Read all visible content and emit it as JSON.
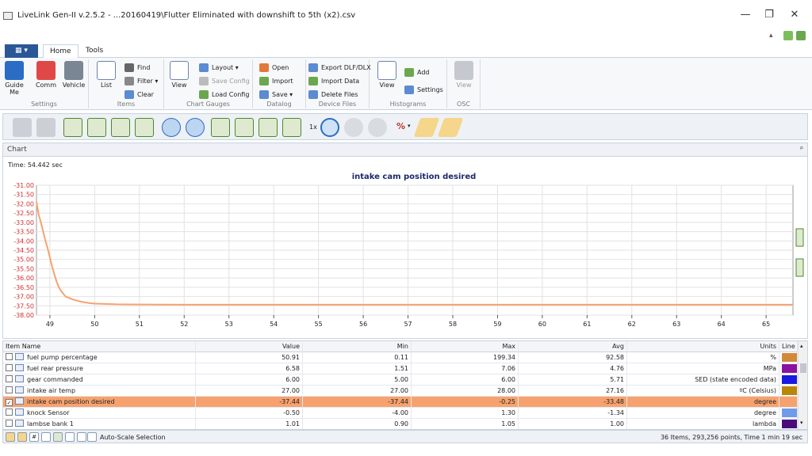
{
  "window": {
    "title": "LiveLink Gen-II  v.2.5.2 - ...20160419\\Flutter Eliminated with downshift to 5th (x2).csv",
    "minimize": "—",
    "maximize": "❐",
    "close": "✕"
  },
  "tabs": [
    {
      "label": "Home"
    },
    {
      "label": "Tools"
    }
  ],
  "ribbon": {
    "guide_label": "Guide\nMe",
    "comm_label": "Comm",
    "vehicle_label": "Vehicle",
    "settings_group": "Settings",
    "list_label": "List",
    "find_label": "Find",
    "filter_label": "Filter ▾",
    "clear_label": "Clear",
    "items_group": "Items",
    "view_label": "View",
    "layout_label": "Layout",
    "save_config_label": "Save Config",
    "load_config_label": "Load Config",
    "chart_gauges_group": "Chart  Gauges",
    "open_label": "Open",
    "import_label": "Import",
    "save_label": "Save ▾",
    "datalog_group": "Datalog",
    "export_label": "Export DLF/DLX",
    "import_data_label": "Import Data",
    "delete_files_label": "Delete Files",
    "device_files_group": "Device Files",
    "hist_view_label": "View",
    "add_label": "Add",
    "hist_settings_label": "Settings",
    "histograms_group": "Histograms",
    "osc_view_label": "View",
    "osc_group": "OSC"
  },
  "toolbar": {
    "speed_label": "1x",
    "percent_label": "%"
  },
  "chart_panel": {
    "header": "Chart",
    "pin": "ᵖ",
    "time_label": "Time: 54.442 sec"
  },
  "chart_data": {
    "type": "line",
    "title": "intake cam position desired",
    "xlabel": "",
    "ylabel": "",
    "xlim": [
      48.7,
      65.6
    ],
    "ylim": [
      -38.0,
      -31.0
    ],
    "xticks": [
      "49",
      "50",
      "51",
      "52",
      "53",
      "54",
      "55",
      "56",
      "57",
      "58",
      "59",
      "60",
      "61",
      "62",
      "63",
      "64",
      "65"
    ],
    "yticks": [
      "-31.00",
      "-31.50",
      "-32.00",
      "-32.50",
      "-33.00",
      "-33.50",
      "-34.00",
      "-34.50",
      "-35.00",
      "-35.50",
      "-36.00",
      "-36.50",
      "-37.00",
      "-37.50",
      "-38.00"
    ],
    "grid": true,
    "series": [
      {
        "color": "#f7a26e",
        "x": [
          48.7,
          48.75,
          48.8,
          48.85,
          48.9,
          48.95,
          49.0,
          49.05,
          49.1,
          49.15,
          49.2,
          49.25,
          49.3,
          49.35,
          49.4,
          49.5,
          49.6,
          49.7,
          49.8,
          49.9,
          50.0,
          50.2,
          50.5,
          51.0,
          52.0,
          53.0,
          54.0,
          55.0,
          56.0,
          57.0,
          58.0,
          59.0,
          60.0,
          61.0,
          62.0,
          63.0,
          64.0,
          65.0,
          65.6
        ],
        "y": [
          -31.9,
          -32.6,
          -33.0,
          -33.5,
          -34.0,
          -34.4,
          -34.9,
          -35.4,
          -35.8,
          -36.2,
          -36.5,
          -36.7,
          -36.85,
          -37.0,
          -37.05,
          -37.15,
          -37.22,
          -37.28,
          -37.32,
          -37.36,
          -37.38,
          -37.4,
          -37.42,
          -37.43,
          -37.44,
          -37.44,
          -37.44,
          -37.44,
          -37.44,
          -37.44,
          -37.44,
          -37.44,
          -37.44,
          -37.44,
          -37.44,
          -37.44,
          -37.44,
          -37.44,
          -37.44
        ]
      }
    ]
  },
  "grid": {
    "headers": {
      "name": "Item Name",
      "value": "Value",
      "min": "Min",
      "max": "Max",
      "avg": "Avg",
      "units": "Units",
      "line": "Line"
    },
    "rows": [
      {
        "checked": "",
        "name": "fuel pump percentage",
        "value": "50.91",
        "min": "0.11",
        "max": "199.34",
        "avg": "92.58",
        "units": "%",
        "color": "#d08a3a"
      },
      {
        "checked": "",
        "name": "fuel rear pressure",
        "value": "6.58",
        "min": "1.51",
        "max": "7.06",
        "avg": "4.76",
        "units": "MPa",
        "color": "#8a12a0"
      },
      {
        "checked": "",
        "name": "gear commanded",
        "value": "6.00",
        "min": "5.00",
        "max": "6.00",
        "avg": "5.71",
        "units": "SED (state encoded data)",
        "color": "#1a1ae0"
      },
      {
        "checked": "",
        "name": "intake air temp",
        "value": "27.00",
        "min": "27.00",
        "max": "28.00",
        "avg": "27.16",
        "units": "ºC (Celsius)",
        "color": "#b8860b"
      },
      {
        "checked": "✓",
        "name": "intake cam position desired",
        "value": "-37.44",
        "min": "-37.44",
        "max": "-0.25",
        "avg": "-33.48",
        "units": "degree",
        "color": "#f7a26e"
      },
      {
        "checked": "",
        "name": "knock Sensor",
        "value": "-0.50",
        "min": "-4.00",
        "max": "1.30",
        "avg": "-1.34",
        "units": "degree",
        "color": "#6f9be8"
      },
      {
        "checked": "",
        "name": "lambse bank 1",
        "value": "1.01",
        "min": "0.90",
        "max": "1.05",
        "avg": "1.00",
        "units": "lambda",
        "color": "#4a0a7a"
      }
    ]
  },
  "statusbar": {
    "autoscale_label": "Auto-Scale Selection",
    "summary": "36 Items, 293,256 points, Time 1 min 19 sec"
  }
}
